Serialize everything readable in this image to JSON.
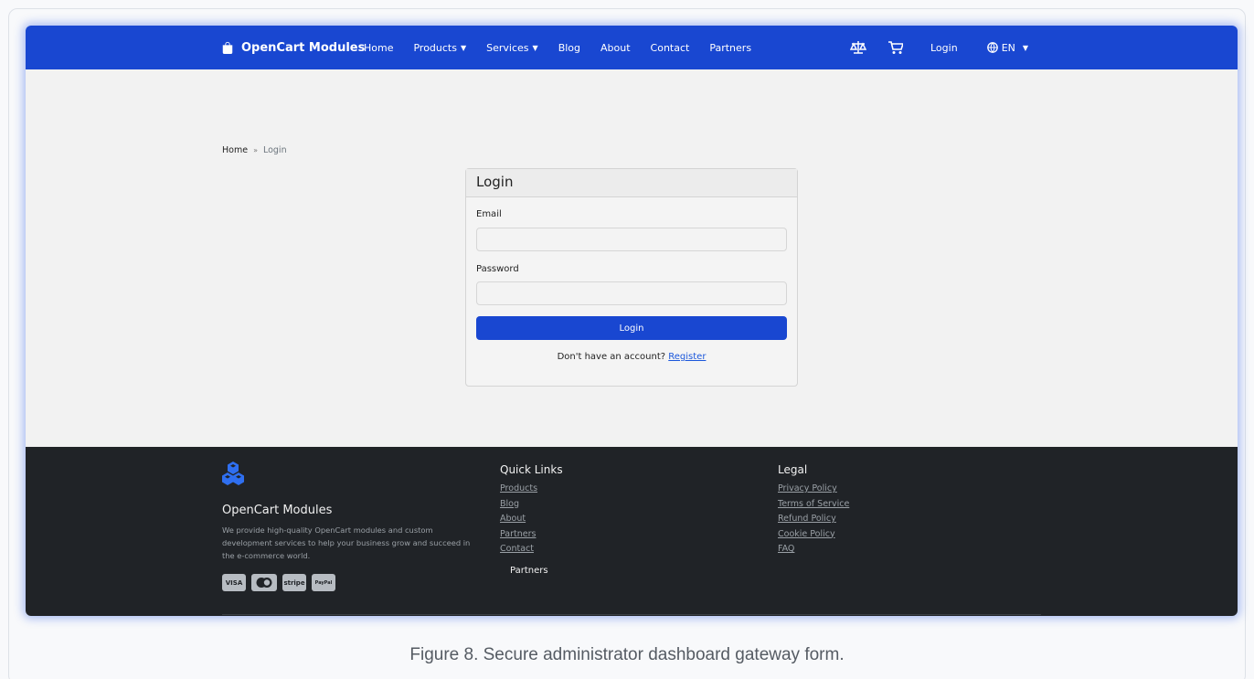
{
  "nav": {
    "brand": "OpenCart Modules",
    "links": [
      "Home",
      "Products",
      "Services",
      "Blog",
      "About",
      "Contact",
      "Partners"
    ],
    "login": "Login",
    "lang": "EN",
    "icons": [
      "shopping-bag-icon",
      "scale-icon",
      "cart-icon",
      "globe-icon"
    ],
    "color": "#1947d1"
  },
  "breadcrumb": {
    "home": "Home",
    "separator": "»",
    "current": "Login"
  },
  "login_card": {
    "title": "Login",
    "email_label": "Email",
    "email_value": "",
    "password_label": "Password",
    "password_value": "",
    "button_label": "Login",
    "register_prompt": "Don't have an account?",
    "register_link": "Register"
  },
  "footer": {
    "brand": "OpenCart Modules",
    "description": "We provide high-quality OpenCart modules and custom development services to help your business grow and succeed in the e-commerce world.",
    "payments": [
      "VISA",
      "Mastercard",
      "stripe",
      "PayPal"
    ],
    "quick_links": {
      "title": "Quick Links",
      "items": [
        "Products",
        "Blog",
        "About",
        "Partners",
        "Contact"
      ]
    },
    "partners_label": "Partners",
    "legal": {
      "title": "Legal",
      "items": [
        "Privacy Policy",
        "Terms of Service",
        "Refund Policy",
        "Cookie Policy",
        "FAQ"
      ]
    },
    "background": "#202327"
  },
  "caption": "Figure 8. Secure administrator dashboard gateway form."
}
